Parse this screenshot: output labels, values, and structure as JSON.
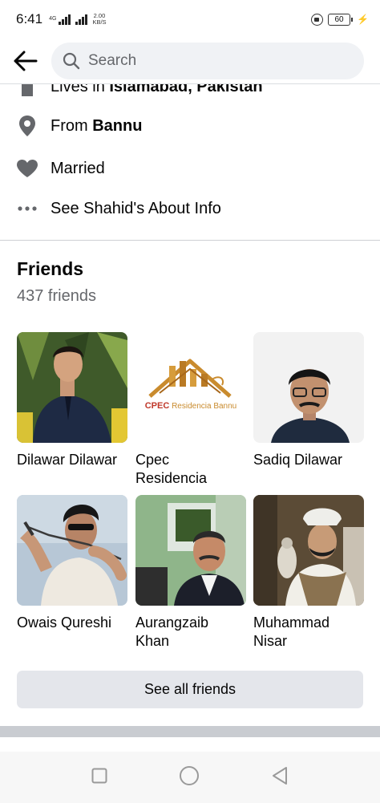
{
  "status_bar": {
    "time": "6:41",
    "network_label": "4G",
    "speed_value": "2.00",
    "speed_unit": "KB/S",
    "battery": "60"
  },
  "header": {
    "back_icon": "arrow-left-icon",
    "search_placeholder": "Search"
  },
  "about": {
    "lives_in_prefix": "Lives in",
    "lives_in_place": "Islamabad, Pakistan",
    "from_prefix": "From",
    "from_place": "Bannu",
    "relationship": "Married",
    "see_about": "See Shahid's About Info"
  },
  "friends": {
    "title": "Friends",
    "count": "437 friends",
    "list": [
      {
        "name": "Dilawar Dilawar"
      },
      {
        "name": "Cpec Residencia",
        "logo_main": "CPEC",
        "logo_sub": "Residencia Bannu"
      },
      {
        "name": "Sadiq Dilawar"
      },
      {
        "name": "Owais Qureshi"
      },
      {
        "name": "Aurangzaib Khan"
      },
      {
        "name": "Muhammad Nisar"
      }
    ],
    "see_all": "See all friends"
  },
  "colors": {
    "accent_gray": "#65676b",
    "button_bg": "#e4e6eb",
    "search_bg": "#f0f2f5"
  }
}
